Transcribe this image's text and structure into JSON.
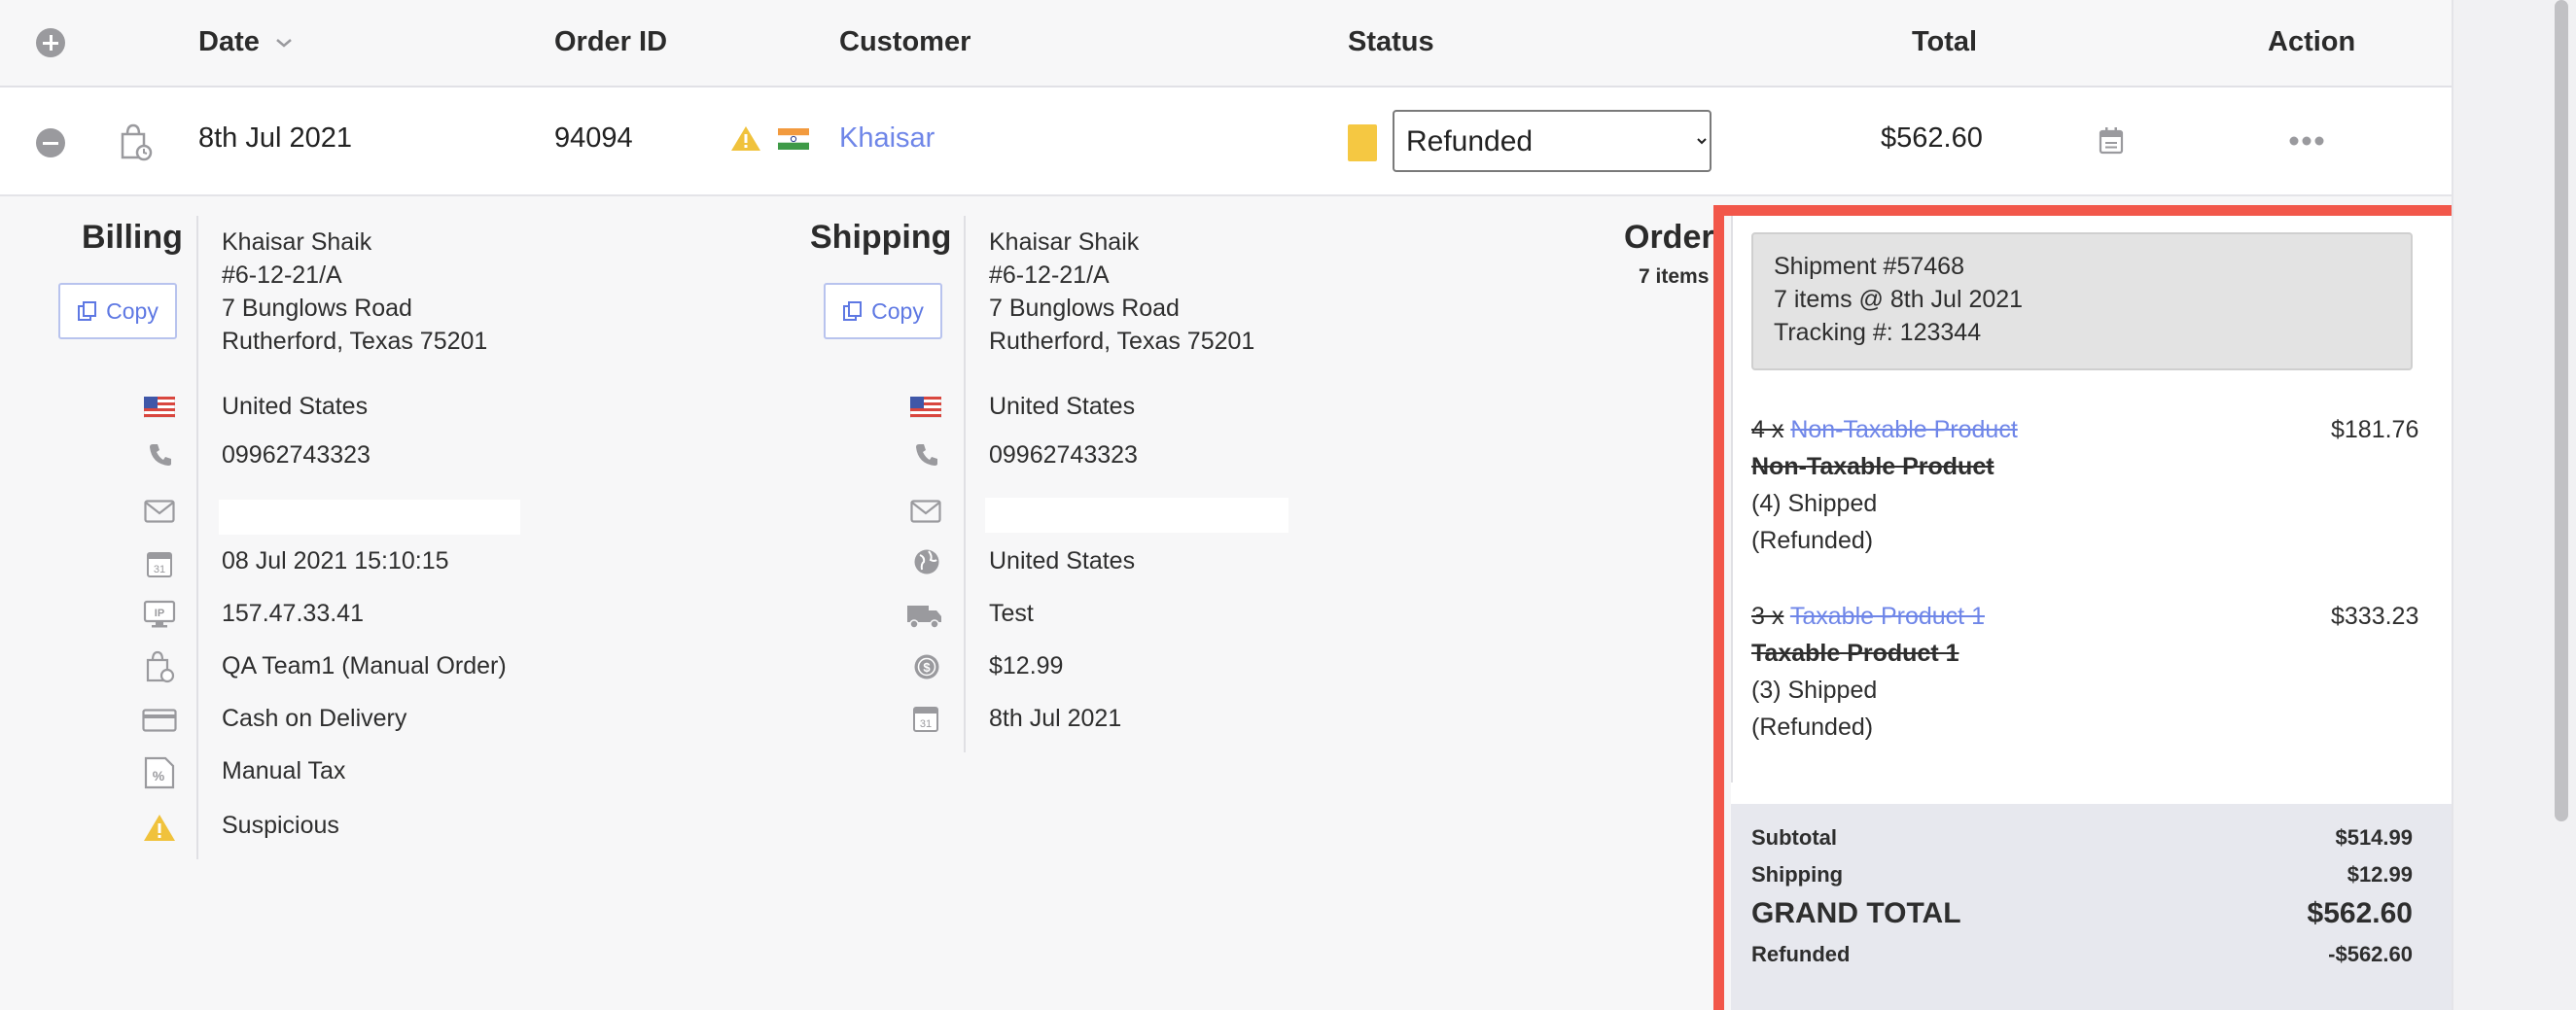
{
  "header": {
    "add_icon": "plus-circle-icon",
    "columns": {
      "date": "Date",
      "order_id": "Order ID",
      "customer": "Customer",
      "status": "Status",
      "total": "Total",
      "action": "Action"
    }
  },
  "order": {
    "date": "8th Jul 2021",
    "order_id": "94094",
    "customer": "Khaisar",
    "status": "Refunded",
    "status_options": [
      "Refunded"
    ],
    "status_color": "#f5c842",
    "total": "$562.60"
  },
  "billing": {
    "title": "Billing",
    "copy_label": "Copy",
    "address": [
      "Khaisar Shaik",
      "#6-12-21/A",
      "7 Bunglows Road",
      "Rutherford, Texas 75201"
    ],
    "country": "United States",
    "phone": "09962743323",
    "created": "08 Jul 2021 15:10:15",
    "ip": "157.47.33.41",
    "created_by": "QA Team1 (Manual Order)",
    "payment": "Cash on Delivery",
    "tax": "Manual Tax",
    "risk": "Suspicious"
  },
  "shipping": {
    "title": "Shipping",
    "copy_label": "Copy",
    "address": [
      "Khaisar Shaik",
      "#6-12-21/A",
      "7 Bunglows Road",
      "Rutherford, Texas 75201"
    ],
    "country": "United States",
    "phone": "09962743323",
    "geo_country": "United States",
    "method": "Test",
    "cost": "$12.99",
    "date": "8th Jul 2021"
  },
  "order_section": {
    "title": "Order",
    "items_count": "7 items"
  },
  "shipment": {
    "title": "Shipment #57468",
    "summary": "7 items @ 8th Jul 2021",
    "tracking": "Tracking #: 123344",
    "items": [
      {
        "qty": "4 x",
        "link": "Non-Taxable Product",
        "name": "Non-Taxable Product",
        "shipped": "(4) Shipped",
        "state": "(Refunded)",
        "price": "$181.76"
      },
      {
        "qty": "3 x",
        "link": "Taxable Product 1",
        "name": "Taxable Product 1",
        "shipped": "(3) Shipped",
        "state": "(Refunded)",
        "price": "$333.23"
      }
    ]
  },
  "totals": {
    "subtotal_label": "Subtotal",
    "subtotal": "$514.99",
    "shipping_label": "Shipping",
    "shipping": "$12.99",
    "grand_label": "GRAND TOTAL",
    "grand": "$562.60",
    "refunded_label": "Refunded",
    "refunded": "-$562.60"
  },
  "colors": {
    "link": "#6f86e8",
    "highlight": "#f2574a",
    "warning": "#f0c23c",
    "status": "#f5c842"
  }
}
